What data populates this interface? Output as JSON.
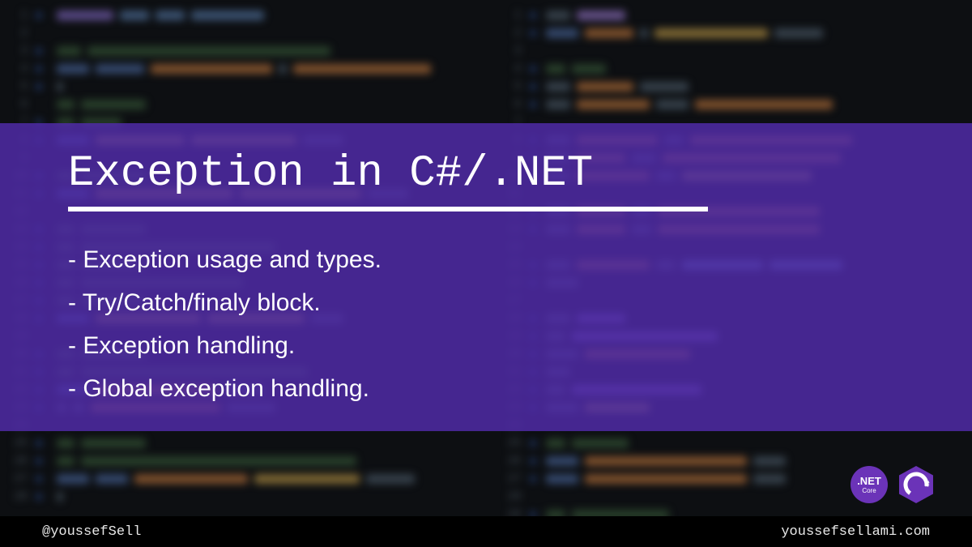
{
  "title": "Exception in C#/.NET",
  "bullets": [
    "- Exception usage and types.",
    "- Try/Catch/finaly block.",
    "- Exception handling.",
    "- Global exception handling."
  ],
  "footer": {
    "handle": "@youssefSell",
    "site": "youssefsellami.com"
  },
  "badges": {
    "dotnet_top": ".NET",
    "dotnet_sub": "Core",
    "csharp": "C#"
  },
  "bg_code": {
    "left": [
      {
        "n": 1,
        "d": 1,
        "t": [
          [
            "#8a6fd2",
            70
          ],
          [
            "#5a7fb0",
            36
          ],
          [
            "#5a7fb0",
            36
          ],
          [
            "#5a7fb0",
            90
          ]
        ]
      },
      {
        "n": 2,
        "d": 0,
        "t": []
      },
      {
        "n": 3,
        "d": 1,
        "t": [
          [
            "#3b5f3b",
            30
          ],
          [
            "#3b5f3b",
            300
          ]
        ]
      },
      {
        "n": 4,
        "d": 1,
        "t": [
          [
            "#4f6ea8",
            40
          ],
          [
            "#4f6ea8",
            60
          ],
          [
            "#c97c3e",
            150
          ],
          [
            "#506070",
            10
          ],
          [
            "#c97c3e",
            170
          ]
        ]
      },
      {
        "n": 5,
        "d": 1,
        "t": [
          [
            "#506070",
            8
          ]
        ]
      },
      {
        "n": 6,
        "d": 0,
        "t": [
          [
            "#3b5f3b",
            22
          ],
          [
            "#3b5f3b",
            80
          ]
        ]
      },
      {
        "n": 7,
        "d": 1,
        "t": [
          [
            "#3b5f3b",
            22
          ],
          [
            "#3b5f3b",
            50
          ]
        ]
      },
      {
        "n": 8,
        "d": 1,
        "t": [
          [
            "#4f6ea8",
            40
          ],
          [
            "#c9a24a",
            110
          ],
          [
            "#c9a24a",
            130
          ],
          [
            "#506070",
            50
          ]
        ]
      },
      {
        "n": 9,
        "d": 0,
        "t": []
      },
      {
        "n": 10,
        "d": 1,
        "t": [
          [
            "#3b5f3b",
            22
          ],
          [
            "#3b5f3b",
            80
          ]
        ]
      },
      {
        "n": 11,
        "d": 1,
        "t": [
          [
            "#4f6ea8",
            40
          ],
          [
            "#c9a24a",
            170
          ],
          [
            "#c9a24a",
            150
          ],
          [
            "#506070",
            50
          ]
        ]
      },
      {
        "n": 12,
        "d": 0,
        "t": []
      },
      {
        "n": 13,
        "d": 1,
        "t": [
          [
            "#3b5f3b",
            22
          ],
          [
            "#3b5f3b",
            80
          ]
        ]
      },
      {
        "n": 14,
        "d": 1,
        "t": [
          [
            "#3b5f3b",
            22
          ],
          [
            "#3b5f3b",
            240
          ]
        ]
      },
      {
        "n": 15,
        "d": 1,
        "t": [
          [
            "#3b5f3b",
            22
          ],
          [
            "#3b5f3b",
            80
          ]
        ]
      },
      {
        "n": 16,
        "d": 1,
        "t": [
          [
            "#3b5f3b",
            22
          ],
          [
            "#3b5f3b",
            200
          ]
        ]
      },
      {
        "n": 17,
        "d": 1,
        "t": [
          [
            "#3b5f3b",
            22
          ],
          [
            "#3b5f3b",
            80
          ]
        ]
      },
      {
        "n": 18,
        "d": 1,
        "t": [
          [
            "#4f6ea8",
            40
          ],
          [
            "#c9a24a",
            130
          ],
          [
            "#c9a24a",
            120
          ],
          [
            "#506070",
            40
          ]
        ]
      },
      {
        "n": 19,
        "d": 0,
        "t": []
      },
      {
        "n": 20,
        "d": 1,
        "t": [
          [
            "#3b5f3b",
            22
          ],
          [
            "#3b5f3b",
            80
          ]
        ]
      },
      {
        "n": 21,
        "d": 1,
        "t": [
          [
            "#3b5f3b",
            22
          ],
          [
            "#3b5f3b",
            280
          ]
        ]
      },
      {
        "n": 22,
        "d": 1,
        "t": [
          [
            "#4f6ea8",
            40
          ],
          [
            "#c97c3e",
            150
          ],
          [
            "#506070",
            50
          ]
        ]
      },
      {
        "n": 23,
        "d": 1,
        "t": [
          [
            "#506070",
            12
          ],
          [
            "#506070",
            14
          ],
          [
            "#c97c3e",
            160
          ],
          [
            "#506070",
            60
          ]
        ]
      },
      {
        "n": 24,
        "d": 0,
        "t": []
      },
      {
        "n": 25,
        "d": 1,
        "t": [
          [
            "#3b5f3b",
            22
          ],
          [
            "#3b5f3b",
            80
          ]
        ]
      },
      {
        "n": 26,
        "d": 1,
        "t": [
          [
            "#3b5f3b",
            22
          ],
          [
            "#3b5f3b",
            340
          ]
        ]
      },
      {
        "n": 27,
        "d": 1,
        "t": [
          [
            "#4f6ea8",
            40
          ],
          [
            "#4f6ea8",
            40
          ],
          [
            "#c97c3e",
            140
          ],
          [
            "#c9a24a",
            130
          ],
          [
            "#506070",
            60
          ]
        ]
      },
      {
        "n": 28,
        "d": 1,
        "t": [
          [
            "#506070",
            8
          ]
        ]
      }
    ],
    "right": [
      {
        "n": 1,
        "d": 1,
        "t": [
          [
            "#506070",
            30
          ],
          [
            "#a07dd8",
            60
          ]
        ]
      },
      {
        "n": 2,
        "d": 1,
        "t": [
          [
            "#4f6ea8",
            40
          ],
          [
            "#c97c3e",
            60
          ],
          [
            "#506070",
            10
          ],
          [
            "#c9a24a",
            140
          ],
          [
            "#506070",
            60
          ]
        ]
      },
      {
        "n": 3,
        "d": 0,
        "t": []
      },
      {
        "n": 4,
        "d": 1,
        "t": [
          [
            "#3b5f3b",
            24
          ],
          [
            "#3b5f3b",
            42
          ]
        ]
      },
      {
        "n": 5,
        "d": 1,
        "t": [
          [
            "#506070",
            30
          ],
          [
            "#c97c3e",
            70
          ],
          [
            "#506070",
            60
          ]
        ]
      },
      {
        "n": 6,
        "d": 1,
        "t": [
          [
            "#506070",
            30
          ],
          [
            "#c97c3e",
            90
          ],
          [
            "#506070",
            40
          ],
          [
            "#c97c3e",
            170
          ]
        ]
      },
      {
        "n": 7,
        "d": 0,
        "t": []
      },
      {
        "n": 8,
        "d": 1,
        "t": [
          [
            "#506070",
            30
          ],
          [
            "#c97c3e",
            100
          ],
          [
            "#506070",
            24
          ],
          [
            "#c97c3e",
            200
          ]
        ]
      },
      {
        "n": 9,
        "d": 1,
        "t": [
          [
            "#506070",
            30
          ],
          [
            "#c97c3e",
            60
          ],
          [
            "#506070",
            30
          ],
          [
            "#c97c3e",
            220
          ]
        ]
      },
      {
        "n": 10,
        "d": 1,
        "t": [
          [
            "#506070",
            30
          ],
          [
            "#c97c3e",
            90
          ],
          [
            "#506070",
            24
          ],
          [
            "#c9a24a",
            160
          ]
        ]
      },
      {
        "n": 11,
        "d": 0,
        "t": []
      },
      {
        "n": 12,
        "d": 1,
        "t": [
          [
            "#506070",
            30
          ],
          [
            "#c97c3e",
            60
          ],
          [
            "#506070",
            24
          ],
          [
            "#c97c3e",
            200
          ]
        ]
      },
      {
        "n": 13,
        "d": 1,
        "t": [
          [
            "#506070",
            30
          ],
          [
            "#c97c3e",
            60
          ],
          [
            "#506070",
            24
          ],
          [
            "#c97c3e",
            200
          ]
        ]
      },
      {
        "n": 14,
        "d": 0,
        "t": []
      },
      {
        "n": 15,
        "d": 1,
        "t": [
          [
            "#506070",
            30
          ],
          [
            "#c97c3e",
            90
          ],
          [
            "#506070",
            24
          ],
          [
            "#6fa0d8",
            100
          ],
          [
            "#6fa0d8",
            90
          ]
        ]
      },
      {
        "n": 16,
        "d": 1,
        "t": [
          [
            "#506070",
            40
          ]
        ]
      },
      {
        "n": 17,
        "d": 0,
        "t": []
      },
      {
        "n": 18,
        "d": 1,
        "t": [
          [
            "#506070",
            30
          ],
          [
            "#8a6fd2",
            60
          ]
        ]
      },
      {
        "n": 19,
        "d": 1,
        "t": [
          [
            "#506070",
            24
          ],
          [
            "#8a6fd2",
            180
          ]
        ]
      },
      {
        "n": 20,
        "d": 1,
        "t": [
          [
            "#506070",
            40
          ],
          [
            "#c97c3e",
            130
          ]
        ]
      },
      {
        "n": 21,
        "d": 1,
        "t": [
          [
            "#506070",
            30
          ]
        ]
      },
      {
        "n": 22,
        "d": 1,
        "t": [
          [
            "#506070",
            24
          ],
          [
            "#8a6fd2",
            160
          ]
        ]
      },
      {
        "n": 23,
        "d": 1,
        "t": [
          [
            "#506070",
            40
          ],
          [
            "#c9a24a",
            80
          ]
        ]
      },
      {
        "n": 24,
        "d": 0,
        "t": []
      },
      {
        "n": 25,
        "d": 1,
        "t": [
          [
            "#3b5f3b",
            24
          ],
          [
            "#3b5f3b",
            70
          ]
        ]
      },
      {
        "n": 26,
        "d": 1,
        "t": [
          [
            "#4f6ea8",
            40
          ],
          [
            "#c97c3e",
            200
          ],
          [
            "#506070",
            40
          ]
        ]
      },
      {
        "n": 27,
        "d": 1,
        "t": [
          [
            "#4f6ea8",
            40
          ],
          [
            "#c97c3e",
            200
          ],
          [
            "#506070",
            40
          ]
        ]
      },
      {
        "n": 28,
        "d": 0,
        "t": []
      },
      {
        "n": 29,
        "d": 1,
        "t": [
          [
            "#3b5f3b",
            24
          ],
          [
            "#3b5f3b",
            120
          ]
        ]
      }
    ]
  }
}
